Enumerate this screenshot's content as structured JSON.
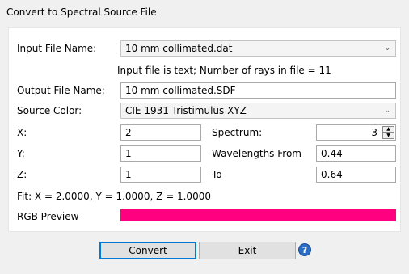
{
  "window": {
    "title": "Convert to Spectral Source File"
  },
  "input_file": {
    "label": "Input File Name:",
    "value": "10 mm collimated.dat"
  },
  "info_text": "Input file is text; Number of rays in file = 11",
  "output_file": {
    "label": "Output File Name:",
    "value": "10 mm collimated.SDF"
  },
  "source_color": {
    "label": "Source Color:",
    "value": "CIE 1931 Tristimulus XYZ"
  },
  "x": {
    "label": "X:",
    "value": "2"
  },
  "y": {
    "label": "Y:",
    "value": "1"
  },
  "z": {
    "label": "Z:",
    "value": "1"
  },
  "spectrum": {
    "label": "Spectrum:",
    "value": "3"
  },
  "wavelengths_from": {
    "label": "Wavelengths From",
    "value": "0.44"
  },
  "wavelengths_to": {
    "label": "To",
    "value": "0.64"
  },
  "fit_text": "Fit: X = 2.0000, Y = 1.0000, Z = 1.0000",
  "rgb_preview": {
    "label": "RGB Preview",
    "color": "#ff0080"
  },
  "buttons": {
    "convert": "Convert",
    "exit": "Exit",
    "help": "?"
  },
  "icons": {
    "dropdown": "chevron-down-icon",
    "help": "help-icon"
  }
}
